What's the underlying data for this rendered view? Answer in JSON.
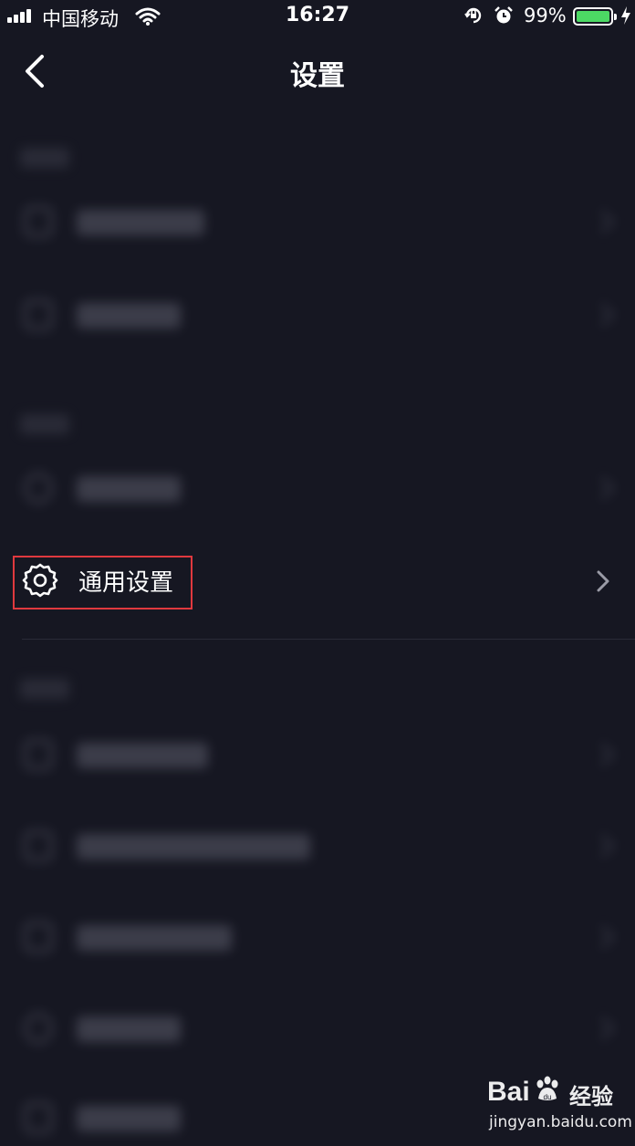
{
  "status_bar": {
    "carrier": "中国移动",
    "time": "16:27",
    "battery_percent": "99%",
    "battery_level": 0.99,
    "icons": [
      "signal-icon",
      "wifi-icon",
      "rotation-lock-icon",
      "alarm-icon",
      "battery-icon",
      "charging-icon"
    ]
  },
  "nav": {
    "title": "设置",
    "back_icon": "chevron-left-icon"
  },
  "settings": {
    "general": {
      "label": "通用设置",
      "icon": "gear-icon",
      "chevron": "chevron-right-icon",
      "highlight_color": "#e0393e"
    }
  },
  "watermark": {
    "logo_text": "Bai",
    "logo_text2": "du",
    "brand": "经验",
    "url": "jingyan.baidu.com"
  },
  "colors": {
    "background": "#161722",
    "battery": "#4cd964",
    "text": "#ffffff"
  }
}
